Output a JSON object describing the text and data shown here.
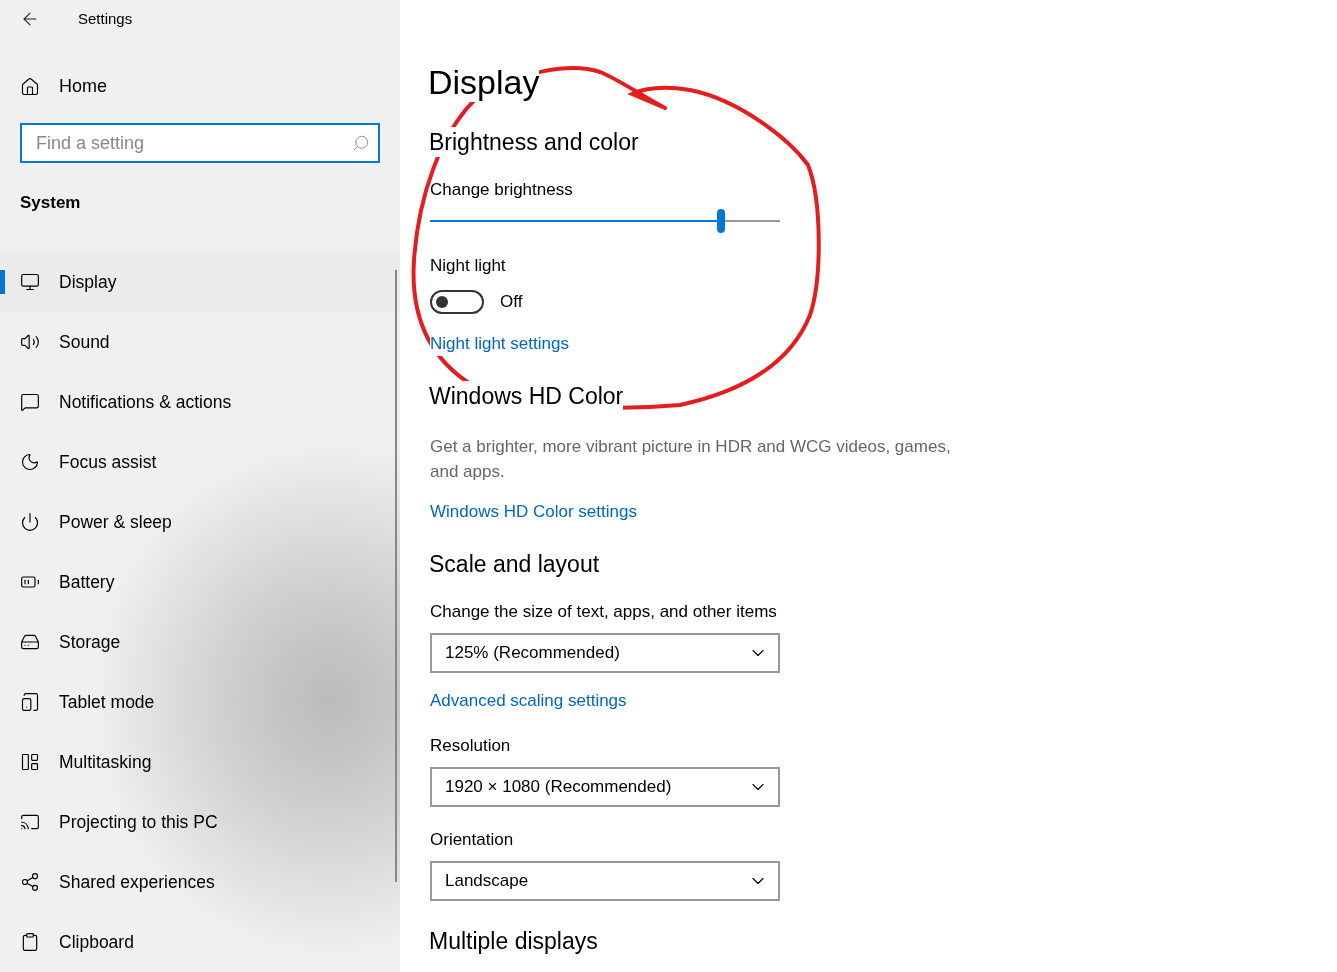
{
  "window": {
    "title": "Settings"
  },
  "sidebar": {
    "home": "Home",
    "search": {
      "placeholder": "Find a setting"
    },
    "section": "System",
    "items": [
      {
        "label": "Display",
        "selected": true
      },
      {
        "label": "Sound",
        "selected": false
      },
      {
        "label": "Notifications & actions",
        "selected": false
      },
      {
        "label": "Focus assist",
        "selected": false
      },
      {
        "label": "Power & sleep",
        "selected": false
      },
      {
        "label": "Battery",
        "selected": false
      },
      {
        "label": "Storage",
        "selected": false
      },
      {
        "label": "Tablet mode",
        "selected": false
      },
      {
        "label": "Multitasking",
        "selected": false
      },
      {
        "label": "Projecting to this PC",
        "selected": false
      },
      {
        "label": "Shared experiences",
        "selected": false
      },
      {
        "label": "Clipboard",
        "selected": false
      }
    ]
  },
  "main": {
    "title": "Display",
    "blocks": [
      {
        "kind": "heading",
        "text": "Brightness and color"
      },
      {
        "kind": "label",
        "text": "Change brightness"
      },
      {
        "kind": "slider",
        "level": 0.83
      },
      {
        "kind": "label",
        "text": "Night light"
      },
      {
        "kind": "toggle",
        "on": false,
        "text": "Off"
      },
      {
        "kind": "link",
        "text": "Night light settings"
      },
      {
        "kind": "heading",
        "text": "Windows HD Color"
      },
      {
        "kind": "paragraph",
        "text": "Get a brighter, more vibrant picture in HDR and WCG videos, games, and apps."
      },
      {
        "kind": "link",
        "text": "Windows HD Color settings"
      },
      {
        "kind": "heading",
        "text": "Scale and layout"
      },
      {
        "kind": "label",
        "text": "Change the size of text, apps, and other items"
      },
      {
        "kind": "dropdown",
        "value": "125% (Recommended)"
      },
      {
        "kind": "link",
        "text": "Advanced scaling settings"
      },
      {
        "kind": "label",
        "text": "Resolution"
      },
      {
        "kind": "dropdown",
        "value": "1920 × 1080 (Recommended)"
      },
      {
        "kind": "label",
        "text": "Orientation"
      },
      {
        "kind": "dropdown",
        "value": "Landscape"
      },
      {
        "kind": "heading",
        "text": "Multiple displays"
      }
    ]
  }
}
